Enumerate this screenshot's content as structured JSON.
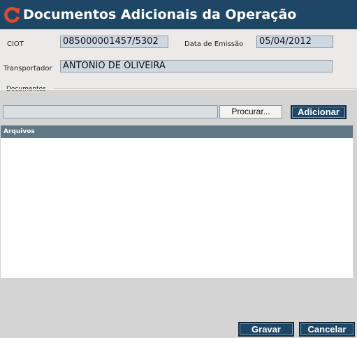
{
  "window": {
    "title": "Documentos Adicionais da Operação",
    "icon": "refresh-icon",
    "colors": {
      "titlebar": "#1e4766",
      "header": "#607785",
      "button": "#1e4766"
    }
  },
  "form": {
    "ciot_label": "CIOT",
    "ciot_value": "085000001457/5302",
    "emissao_label": "Data de Emissão",
    "emissao_value": "05/04/2012",
    "transportador_label": "Transportador",
    "transportador_value": "ANTONIO DE OLIVEIRA"
  },
  "documentos": {
    "legend": "Documentos",
    "file_path": "",
    "browse_label": "Procurar...",
    "add_label": "Adicionar"
  },
  "arquivos": {
    "header": "Arquivos",
    "items": []
  },
  "footer": {
    "save_label": "Gravar",
    "cancel_label": "Cancelar"
  }
}
